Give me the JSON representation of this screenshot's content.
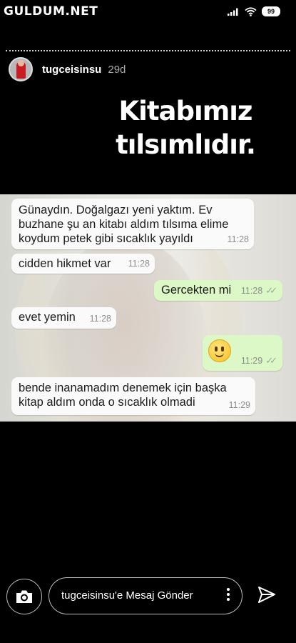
{
  "status_bar": {
    "watermark": "GULDUM.NET",
    "battery": "99",
    "icons": [
      "signal-icon",
      "wifi-icon",
      "battery-icon"
    ]
  },
  "story": {
    "username": "tugceisinsu",
    "time": "29d",
    "caption_line1": "Kitabımız",
    "caption_line2": "tılsımlıdır."
  },
  "chat": {
    "messages": [
      {
        "dir": "in",
        "text": "Günaydın. Doğalgazı yeni yaktım. Ev\nbuzhane şu an kitabı aldım tılsıma elime\nkoydum petek gibi sıcaklık yayıldı",
        "time": "11:28"
      },
      {
        "dir": "in",
        "text": "cidden hikmet var",
        "time": "11:28"
      },
      {
        "dir": "out",
        "text": "Gercekten mi",
        "time": "11:28"
      },
      {
        "dir": "in",
        "text": "evet yemin",
        "time": "11:28"
      },
      {
        "dir": "out",
        "text": "",
        "emoji": "slightly-smiling-face",
        "time": "11:29"
      },
      {
        "dir": "in",
        "text": "bende inanamadım denemek için başka\nkitap aldım onda o sıcaklık olmadi",
        "time": "11:29"
      }
    ],
    "colors": {
      "incoming": "#fafafa",
      "outgoing": "#dcf8c6",
      "meta": "#8d8d8d"
    }
  },
  "bottom_bar": {
    "placeholder": "tugceisinsu'e Mesaj Gönder",
    "icons": [
      "camera-icon",
      "more-vertical-icon",
      "send-icon"
    ]
  }
}
